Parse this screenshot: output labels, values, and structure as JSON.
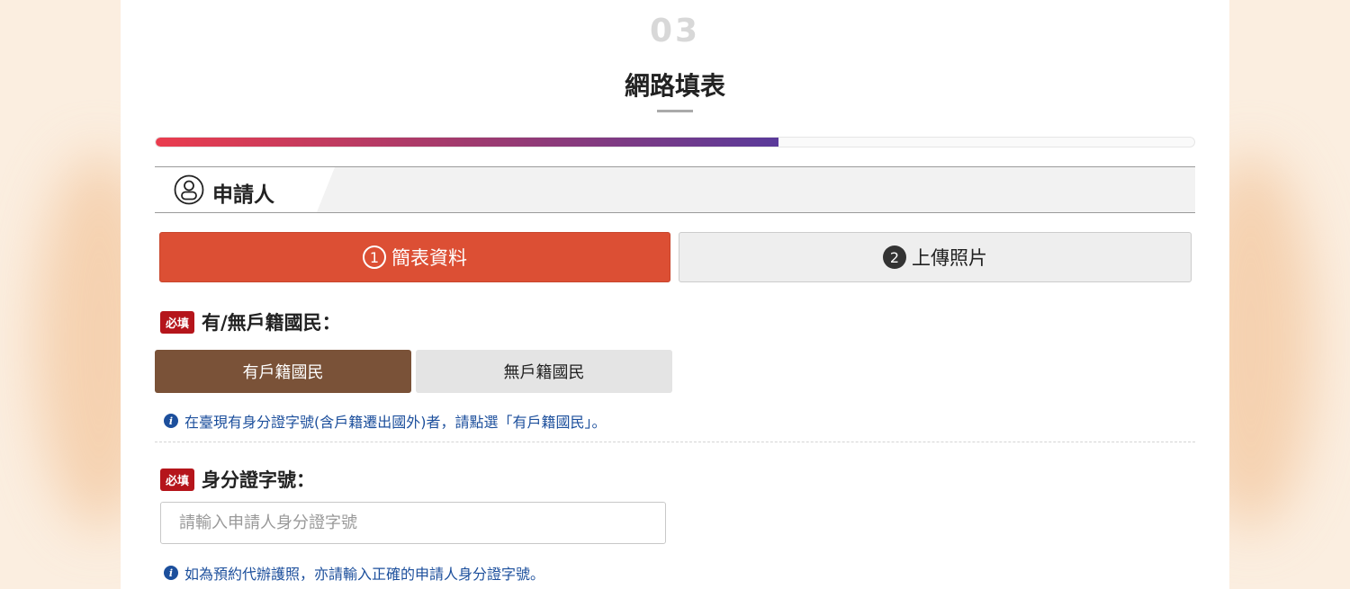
{
  "step": {
    "number": "03",
    "title": "網路填表",
    "progress_percent": 60
  },
  "section": {
    "icon": "person-icon",
    "label": "申請人"
  },
  "tabs": [
    {
      "num": "1",
      "label": "簡表資料",
      "active": true
    },
    {
      "num": "2",
      "label": "上傳照片",
      "active": false
    }
  ],
  "required_badge": "必填",
  "household": {
    "label": "有/無戶籍國民：",
    "options": [
      "有戶籍國民",
      "無戶籍國民"
    ],
    "selected": "有戶籍國民",
    "hint": "在臺現有身分證字號(含戶籍遷出國外)者，請點選「有戶籍國民」。"
  },
  "id_field": {
    "label": "身分證字號：",
    "placeholder": "請輸入申請人身分證字號",
    "value": "",
    "hint": "如為預約代辦護照，亦請輸入正確的申請人身分證字號。"
  },
  "colors": {
    "accent": "#dc4f34",
    "selected_option": "#7a5238",
    "required": "#b5151b",
    "hint": "#1c4f9c"
  }
}
